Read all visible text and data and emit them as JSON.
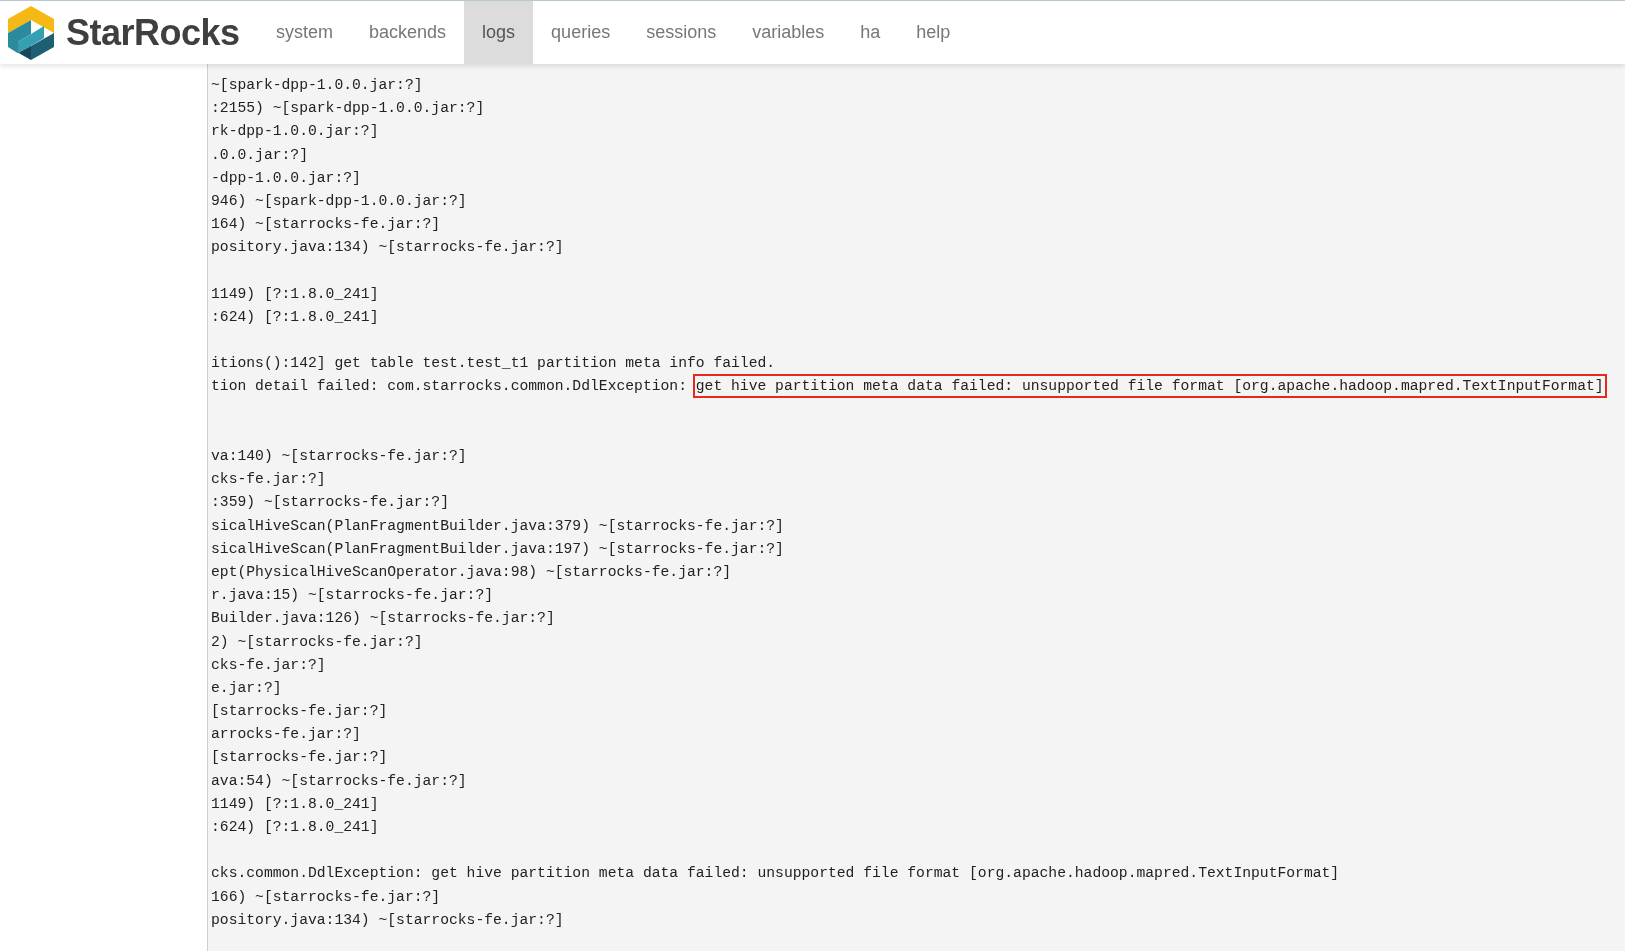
{
  "brand": {
    "name": "StarRocks"
  },
  "nav": [
    {
      "label": "system",
      "selected": false
    },
    {
      "label": "backends",
      "selected": false
    },
    {
      "label": "logs",
      "selected": true
    },
    {
      "label": "queries",
      "selected": false
    },
    {
      "label": "sessions",
      "selected": false
    },
    {
      "label": "variables",
      "selected": false
    },
    {
      "label": "ha",
      "selected": false
    },
    {
      "label": "help",
      "selected": false
    }
  ],
  "log_lines": [
    {
      "kind": "text",
      "text": "~[spark-dpp-1.0.0.jar:?]"
    },
    {
      "kind": "text",
      "text": ":2155) ~[spark-dpp-1.0.0.jar:?]"
    },
    {
      "kind": "text",
      "text": "rk-dpp-1.0.0.jar:?]"
    },
    {
      "kind": "text",
      "text": ".0.0.jar:?]"
    },
    {
      "kind": "text",
      "text": "-dpp-1.0.0.jar:?]"
    },
    {
      "kind": "text",
      "text": "946) ~[spark-dpp-1.0.0.jar:?]"
    },
    {
      "kind": "text",
      "text": "164) ~[starrocks-fe.jar:?]"
    },
    {
      "kind": "text",
      "text": "pository.java:134) ~[starrocks-fe.jar:?]"
    },
    {
      "kind": "blank"
    },
    {
      "kind": "text",
      "text": "1149) [?:1.8.0_241]"
    },
    {
      "kind": "text",
      "text": ":624) [?:1.8.0_241]"
    },
    {
      "kind": "blank"
    },
    {
      "kind": "text",
      "text": "itions():142] get table test.test_t1 partition meta info failed."
    },
    {
      "kind": "highlighted",
      "text": "tion detail failed: com.starrocks.common.DdlException: ",
      "highlight": "get hive partition meta data failed: unsupported file format [org.apache.hadoop.mapred.TextInputFormat]"
    },
    {
      "kind": "blank"
    },
    {
      "kind": "blank"
    },
    {
      "kind": "text",
      "text": "va:140) ~[starrocks-fe.jar:?]"
    },
    {
      "kind": "text",
      "text": "cks-fe.jar:?]"
    },
    {
      "kind": "text",
      "text": ":359) ~[starrocks-fe.jar:?]"
    },
    {
      "kind": "text",
      "text": "sicalHiveScan(PlanFragmentBuilder.java:379) ~[starrocks-fe.jar:?]"
    },
    {
      "kind": "text",
      "text": "sicalHiveScan(PlanFragmentBuilder.java:197) ~[starrocks-fe.jar:?]"
    },
    {
      "kind": "text",
      "text": "ept(PhysicalHiveScanOperator.java:98) ~[starrocks-fe.jar:?]"
    },
    {
      "kind": "text",
      "text": "r.java:15) ~[starrocks-fe.jar:?]"
    },
    {
      "kind": "text",
      "text": "Builder.java:126) ~[starrocks-fe.jar:?]"
    },
    {
      "kind": "text",
      "text": "2) ~[starrocks-fe.jar:?]"
    },
    {
      "kind": "text",
      "text": "cks-fe.jar:?]"
    },
    {
      "kind": "text",
      "text": "e.jar:?]"
    },
    {
      "kind": "text",
      "text": "[starrocks-fe.jar:?]"
    },
    {
      "kind": "text",
      "text": "arrocks-fe.jar:?]"
    },
    {
      "kind": "text",
      "text": "[starrocks-fe.jar:?]"
    },
    {
      "kind": "text",
      "text": "ava:54) ~[starrocks-fe.jar:?]"
    },
    {
      "kind": "text",
      "text": "1149) [?:1.8.0_241]"
    },
    {
      "kind": "text",
      "text": ":624) [?:1.8.0_241]"
    },
    {
      "kind": "blank"
    },
    {
      "kind": "text",
      "text": "cks.common.DdlException: get hive partition meta data failed: unsupported file format [org.apache.hadoop.mapred.TextInputFormat]"
    },
    {
      "kind": "text",
      "text": "166) ~[starrocks-fe.jar:?]"
    },
    {
      "kind": "text",
      "text": "pository.java:134) ~[starrocks-fe.jar:?]"
    }
  ]
}
